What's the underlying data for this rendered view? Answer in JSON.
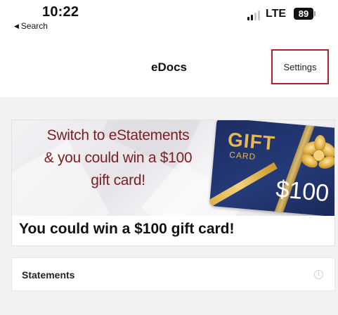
{
  "status_bar": {
    "time": "10:22",
    "back_label": "Search",
    "network": "LTE",
    "battery": "89"
  },
  "nav": {
    "title": "eDocs",
    "settings_label": "Settings"
  },
  "promo": {
    "banner_lines": [
      "Switch to eStatements",
      "& you could win a $100",
      "gift card!"
    ],
    "gift_card": {
      "gift_text": "GIFT",
      "card_text": "CARD",
      "amount": "$100"
    },
    "caption": "You could win a $100 gift card!"
  },
  "statements": {
    "label": "Statements",
    "icon": "info-icon"
  },
  "colors": {
    "banner_text": "#7a1f23",
    "card_navy": "#1d2d63",
    "card_gold": "#e7b84a",
    "settings_highlight": "#b3202a",
    "background": "#f2f2f2"
  }
}
